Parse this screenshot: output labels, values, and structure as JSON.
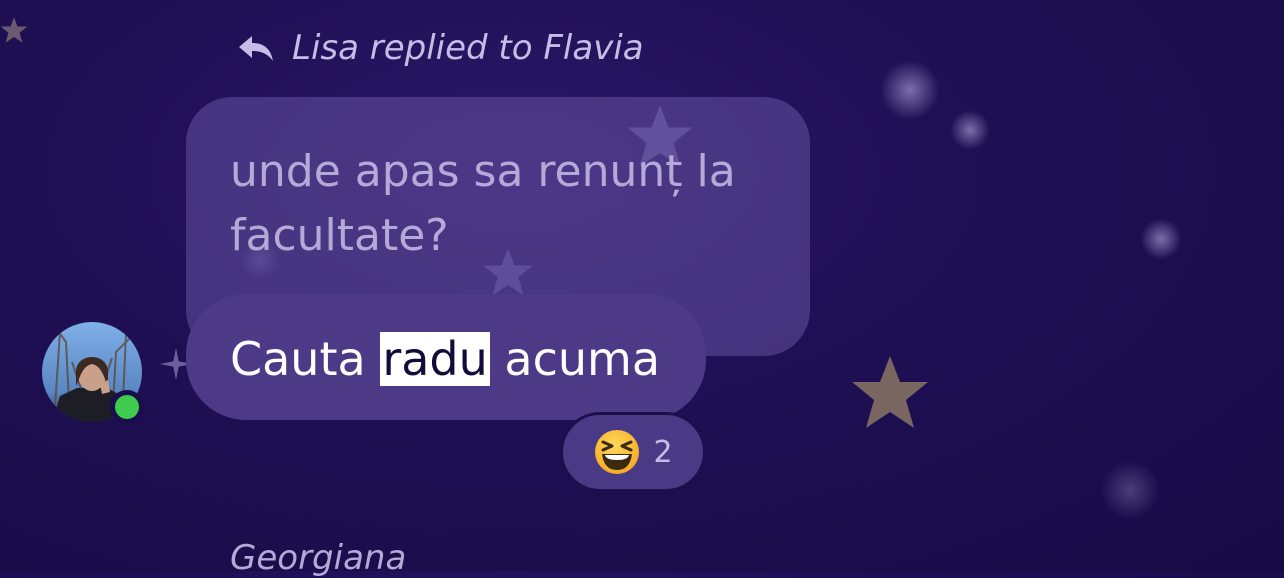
{
  "reply_header": {
    "icon": "reply-arrow-icon",
    "text": "Lisa replied to Flavia"
  },
  "quoted_message": {
    "text": "unde apas sa renunț la facultate?"
  },
  "message": {
    "before": "Cauta ",
    "highlighted": "radu",
    "after": " acuma"
  },
  "sender_avatar": {
    "online": true
  },
  "reaction": {
    "emoji": "grinning-squinting-face",
    "count": "2"
  },
  "next_message": {
    "sender": "Georgiana"
  },
  "colors": {
    "background": "#1f0f55",
    "bubble": "#4d3a86",
    "highlight": "#ffffff",
    "online": "#3fcb4d",
    "secondary_text": "#c6bce6"
  }
}
